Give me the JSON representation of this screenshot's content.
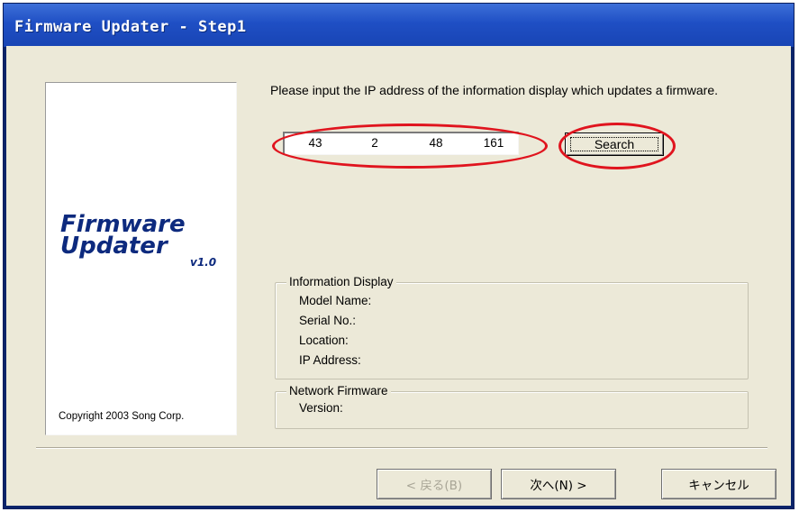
{
  "window": {
    "title": "Firmware Updater - Step1"
  },
  "logo": {
    "line1": "Firmware",
    "line2": "Updater",
    "version": "v1.0",
    "copyright": "Copyright 2003 Song Corp."
  },
  "prompt": "Please input the IP address of the information display which updates a firmware.",
  "ip_address": {
    "octets": [
      "43",
      "2",
      "48",
      "161"
    ]
  },
  "search_button": "Search",
  "information_display": {
    "title": "Information Display",
    "fields": [
      "Model Name:",
      "Serial No.:",
      "Location:",
      "IP Address:"
    ]
  },
  "network_firmware": {
    "title": "Network Firmware",
    "fields": [
      "Version:"
    ]
  },
  "buttons": {
    "back": "< 戻る(B)",
    "next": "次へ(N) >",
    "cancel": "キャンセル"
  },
  "annotation_color": "#e0141e"
}
